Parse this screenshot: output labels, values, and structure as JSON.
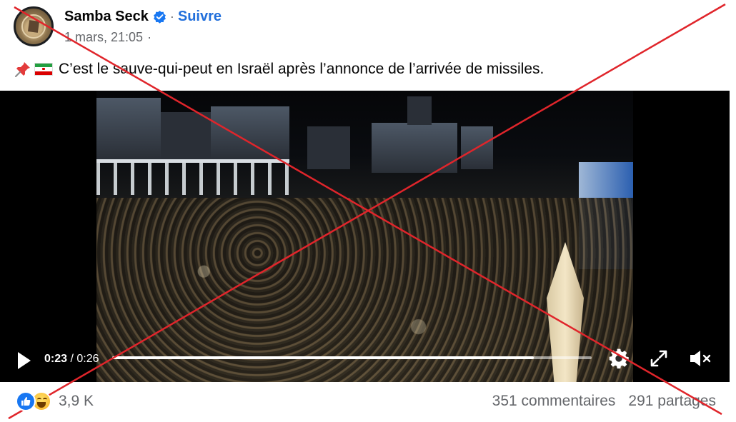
{
  "post": {
    "author": "Samba Seck",
    "follow_label": "Suivre",
    "separator": "·",
    "timestamp": "1 mars, 21:05",
    "audience_separator": "·",
    "text": "C’est le sauve-qui-peut en Israël après l’annonce de l’arrivée de missiles."
  },
  "video": {
    "current_time": "0:23",
    "time_separator": " / ",
    "duration": "0:26",
    "progress_percent": 88
  },
  "footer": {
    "reaction_count": "3,9 K",
    "comments": "351 commentaires",
    "shares": "291 partages"
  },
  "icons": {
    "verified": "verified-badge-icon",
    "pin": "pushpin-icon",
    "flag": "iran-flag-icon",
    "play": "play-icon",
    "settings": "gear-icon",
    "fullscreen": "fullscreen-icon",
    "mute": "muted-speaker-icon",
    "like": "like-reaction-icon",
    "haha": "haha-reaction-icon"
  },
  "colors": {
    "link_blue": "#216fdb",
    "verified_blue": "#1877f2",
    "secondary_text": "#65676b",
    "cross_red": "#e0252b"
  }
}
